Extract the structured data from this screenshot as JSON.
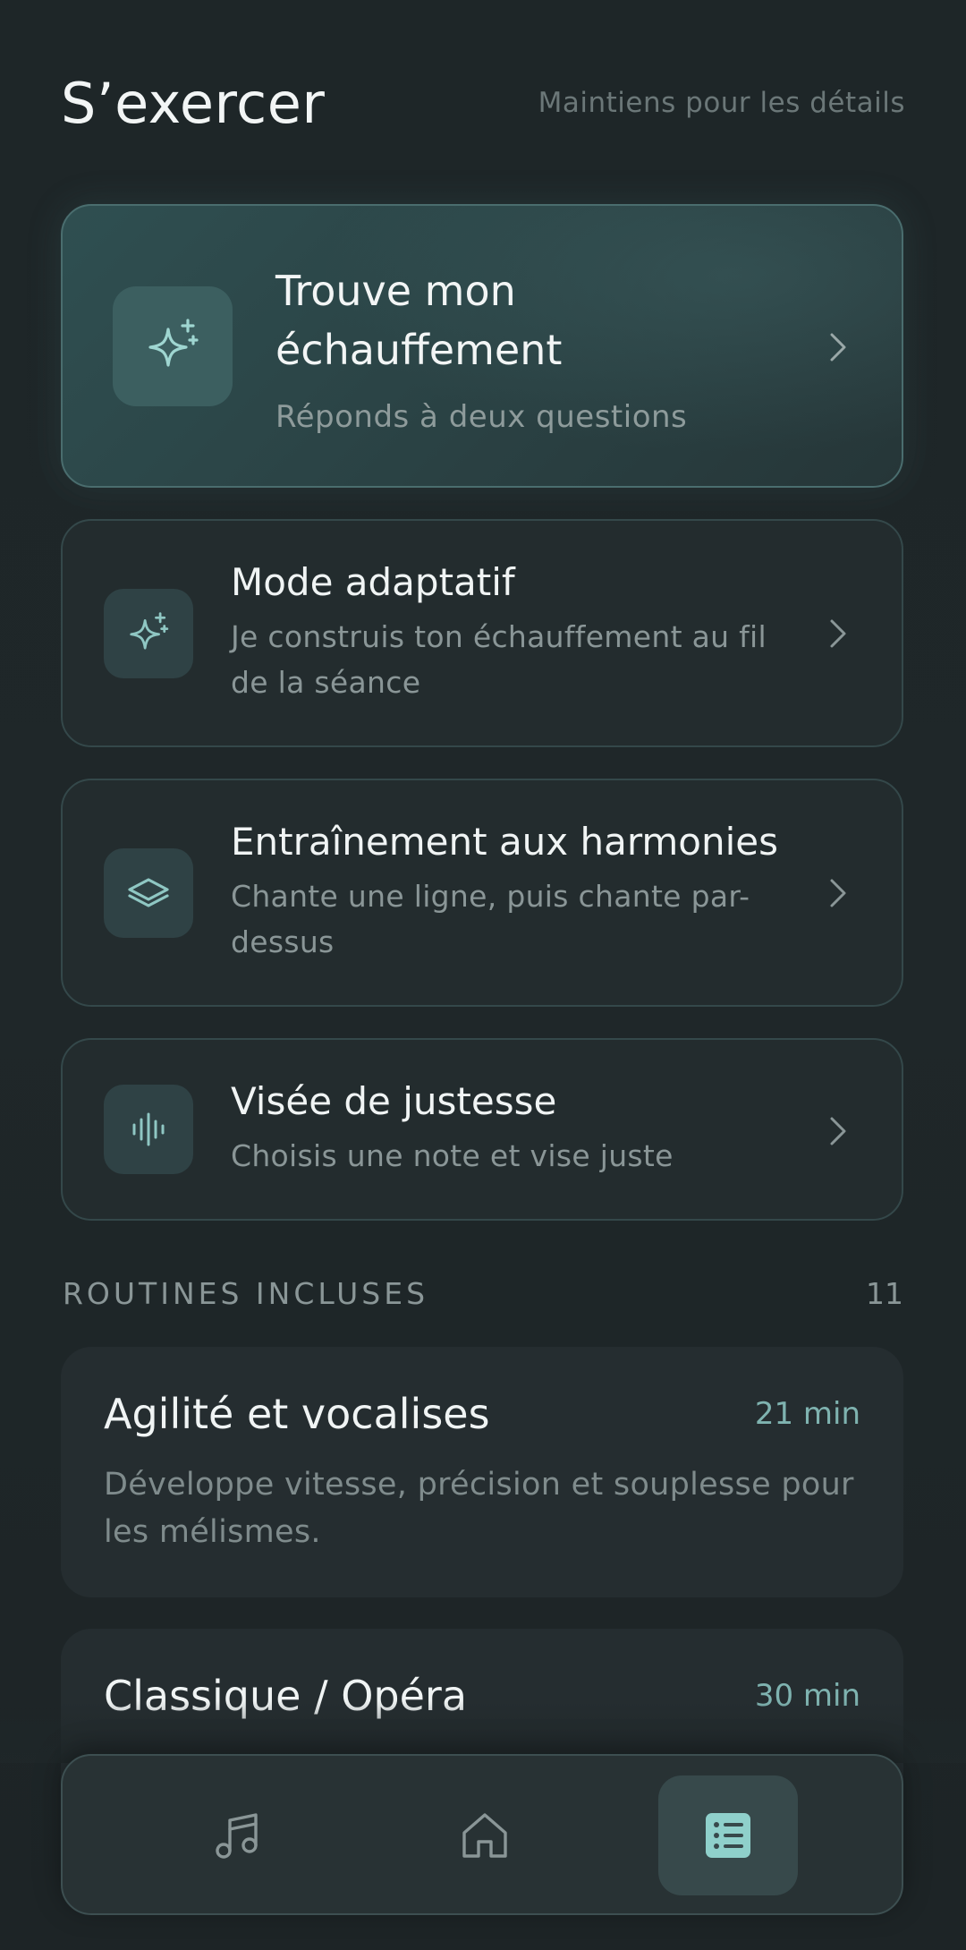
{
  "header": {
    "title": "S’exercer",
    "hint": "Maintiens pour les détails"
  },
  "cards": {
    "hero": {
      "title": "Trouve mon échauffement",
      "subtitle": "Réponds à deux questions",
      "icon": "sparkles-icon"
    },
    "adaptive": {
      "title": "Mode adaptatif",
      "subtitle": "Je construis ton échauffement au fil de la séance",
      "icon": "sparkles-icon"
    },
    "harmony": {
      "title": "Entraînement aux harmonies",
      "subtitle": "Chante une ligne, puis chante par-dessus",
      "icon": "layers-icon"
    },
    "pitch": {
      "title": "Visée de justesse",
      "subtitle": "Choisis une note et vise juste",
      "icon": "waveform-icon"
    }
  },
  "routines_section": {
    "title": "ROUTINES INCLUSES",
    "count": "11"
  },
  "routines": [
    {
      "title": "Agilité et vocalises",
      "duration": "21 min",
      "description": "Développe vitesse, précision et souplesse pour les mélismes."
    },
    {
      "title": "Classique / Opéra",
      "duration": "30 min",
      "description": ""
    }
  ],
  "tabbar": {
    "tabs": [
      {
        "icon": "music-note-icon",
        "active": false
      },
      {
        "icon": "home-icon",
        "active": false
      },
      {
        "icon": "list-icon",
        "active": true
      }
    ]
  },
  "colors": {
    "background": "#1f2628",
    "accent": "#7fb3b0",
    "hero_tile": "#3c5f60",
    "icon_stroke": "#8fc7c3"
  }
}
